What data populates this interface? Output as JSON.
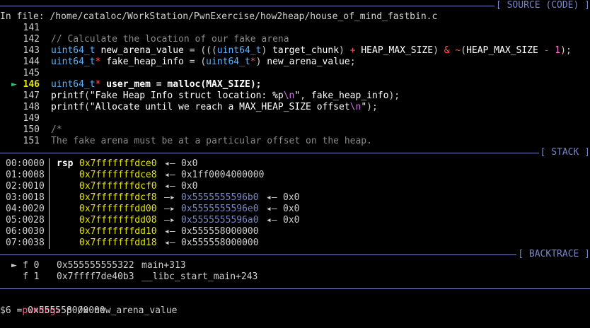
{
  "source": {
    "title": "[ SOURCE (CODE) ]",
    "file_label": "In file: /home/cataloc/WorkStation/PwnExercise/how2heap/house_of_mind_fastbin.c",
    "current_marker": "►",
    "lines": [
      {
        "num": "141",
        "text": ""
      },
      {
        "num": "142",
        "text": "// Calculate the location of our fake arena"
      },
      {
        "num": "143",
        "text": "uint64_t new_arena_value = (((uint64_t) target_chunk) + HEAP_MAX_SIZE) & ~(HEAP_MAX_SIZE - 1);"
      },
      {
        "num": "144",
        "text": "uint64_t* fake_heap_info = (uint64_t*) new_arena_value;"
      },
      {
        "num": "145",
        "text": ""
      },
      {
        "num": "146",
        "text": "uint64_t* user_mem = malloc(MAX_SIZE);"
      },
      {
        "num": "147",
        "text": "printf(\"Fake Heap Info struct location: %p\\n\", fake_heap_info);"
      },
      {
        "num": "148",
        "text": "printf(\"Allocate until we reach a MAX_HEAP_SIZE offset\\n\");"
      },
      {
        "num": "149",
        "text": ""
      },
      {
        "num": "150",
        "text": "/*"
      },
      {
        "num": "151",
        "text": "The fake arena must be at a particular offset on the heap."
      }
    ]
  },
  "stack": {
    "title": "[ STACK ]",
    "rows": [
      {
        "offset": "00:0000",
        "reg": "rsp",
        "addr": "0x7fffffffdce0",
        "arrow": "◂—",
        "value": "0x0",
        "ptr": false,
        "arrow2": "",
        "value2": ""
      },
      {
        "offset": "01:0008",
        "reg": "",
        "addr": "0x7fffffffdce8",
        "arrow": "◂—",
        "value": "0x1ff0004000000",
        "ptr": false,
        "arrow2": "",
        "value2": ""
      },
      {
        "offset": "02:0010",
        "reg": "",
        "addr": "0x7fffffffdcf0",
        "arrow": "◂—",
        "value": "0x0",
        "ptr": false,
        "arrow2": "",
        "value2": ""
      },
      {
        "offset": "03:0018",
        "reg": "",
        "addr": "0x7fffffffdcf8",
        "arrow": "—▸",
        "value": "0x5555555596b0",
        "ptr": true,
        "arrow2": "◂—",
        "value2": "0x0"
      },
      {
        "offset": "04:0020",
        "reg": "",
        "addr": "0x7fffffffdd00",
        "arrow": "—▸",
        "value": "0x5555555596e0",
        "ptr": true,
        "arrow2": "◂—",
        "value2": "0x0"
      },
      {
        "offset": "05:0028",
        "reg": "",
        "addr": "0x7fffffffdd08",
        "arrow": "—▸",
        "value": "0x5555555596a0",
        "ptr": true,
        "arrow2": "◂—",
        "value2": "0x0"
      },
      {
        "offset": "06:0030",
        "reg": "",
        "addr": "0x7fffffffdd10",
        "arrow": "◂—",
        "value": "0x555558000000",
        "ptr": false,
        "arrow2": "",
        "value2": ""
      },
      {
        "offset": "07:0038",
        "reg": "",
        "addr": "0x7fffffffdd18",
        "arrow": "◂—",
        "value": "0x555558000000",
        "ptr": false,
        "arrow2": "",
        "value2": ""
      }
    ]
  },
  "backtrace": {
    "title": "[ BACKTRACE ]",
    "frames": [
      {
        "marker": "►",
        "frame": "f 0",
        "addr": "0x555555555322",
        "sym": "main+313"
      },
      {
        "marker": "",
        "frame": "f 1",
        "addr": "0x7ffff7de40b3",
        "sym": "__libc_start_main+243"
      }
    ]
  },
  "console": {
    "prompt": "pwndbg>",
    "command": " p /x new_arena_value",
    "output": "$6 = 0x555558000000"
  },
  "colors": {
    "background": "#000000",
    "separator": "#7a86c6",
    "address": "#e6e600",
    "type": "#5ab4ff",
    "prompt": "#ff4f8b"
  }
}
